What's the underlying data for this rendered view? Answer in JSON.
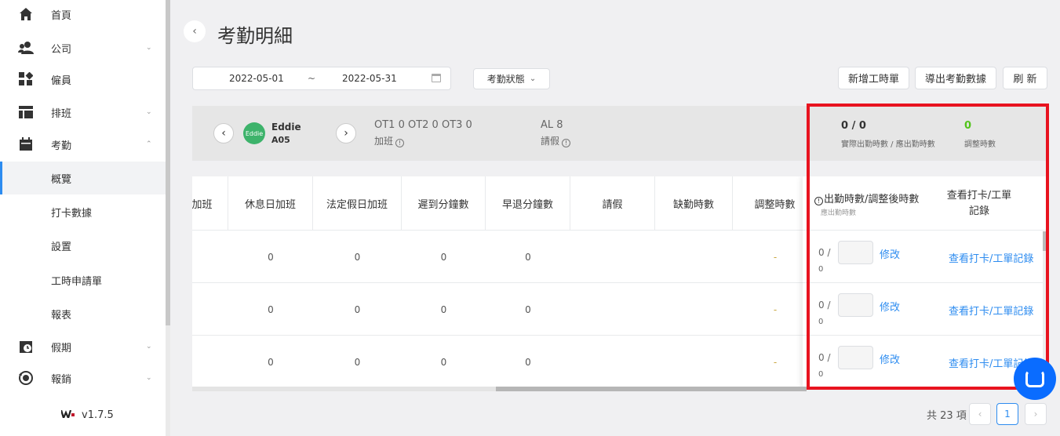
{
  "sidebar": {
    "items": [
      {
        "label": "首頁",
        "icon": "home-icon"
      },
      {
        "label": "公司",
        "icon": "users-icon",
        "chevron": "⌄"
      },
      {
        "label": "僱員",
        "icon": "grid-icon"
      },
      {
        "label": "排班",
        "icon": "table-icon",
        "chevron": "⌄"
      },
      {
        "label": "考勤",
        "icon": "calendar-icon",
        "chevron": "⌃"
      },
      {
        "label": "概覽"
      },
      {
        "label": "打卡數據"
      },
      {
        "label": "設置"
      },
      {
        "label": "工時申請單"
      },
      {
        "label": "報表"
      },
      {
        "label": "假期",
        "icon": "clock-icon",
        "chevron": "⌄"
      },
      {
        "label": "報銷",
        "icon": "refresh-icon",
        "chevron": "⌄"
      }
    ],
    "version": "v1.7.5"
  },
  "header": {
    "title": "考勤明細",
    "date_start": "2022-05-01",
    "date_sep": "~",
    "date_end": "2022-05-31",
    "status_label": "考勤狀態",
    "buttons": {
      "new_timesheet": "新增工時單",
      "export": "導出考勤數據",
      "refresh": "刷 新"
    }
  },
  "employee": {
    "avatar_text": "Eddie",
    "name": "Eddie",
    "id": "A05",
    "ot_summary": "OT1 0 OT2 0 OT3 0",
    "ot_label": "加班",
    "al_summary": "AL 8",
    "al_label": "請假",
    "actual_value": "0 / 0",
    "actual_label": "實際出勤時數 / 應出勤時數",
    "adjust_value": "0",
    "adjust_label": "調整時數"
  },
  "table": {
    "headers": [
      "加班",
      "休息日加班",
      "法定假日加班",
      "遲到分鐘數",
      "早退分鐘數",
      "請假",
      "缺勤時數",
      "調整時數"
    ],
    "rows": [
      [
        "",
        "0",
        "0",
        "0",
        "0",
        "",
        "",
        "-"
      ],
      [
        "",
        "0",
        "0",
        "0",
        "0",
        "",
        "",
        "-"
      ],
      [
        "",
        "0",
        "0",
        "0",
        "0",
        "",
        "",
        "-"
      ]
    ],
    "fixed_header_1": "出勤時數/調整後時數",
    "fixed_header_1_sub": "應出勤時數",
    "fixed_header_2": "查看打卡/工單記錄",
    "fixed_rows": [
      {
        "v0": "0 /",
        "v1": "0",
        "edit": "修改",
        "view": "查看打卡/工單記錄"
      },
      {
        "v0": "0 /",
        "v1": "0",
        "edit": "修改",
        "view": "查看打卡/工單記錄"
      },
      {
        "v0": "0 /",
        "v1": "0",
        "edit": "修改",
        "view": "查看打卡/工單記錄"
      }
    ]
  },
  "pagination": {
    "total": "共 23 項",
    "prev": "‹",
    "current": "1",
    "next": "›"
  },
  "colors": {
    "accent": "#2d8cf0",
    "highlight": "#e8131f",
    "avatar": "#3db36b",
    "adjust": "#52c41a",
    "chat": "#0a6cff"
  }
}
